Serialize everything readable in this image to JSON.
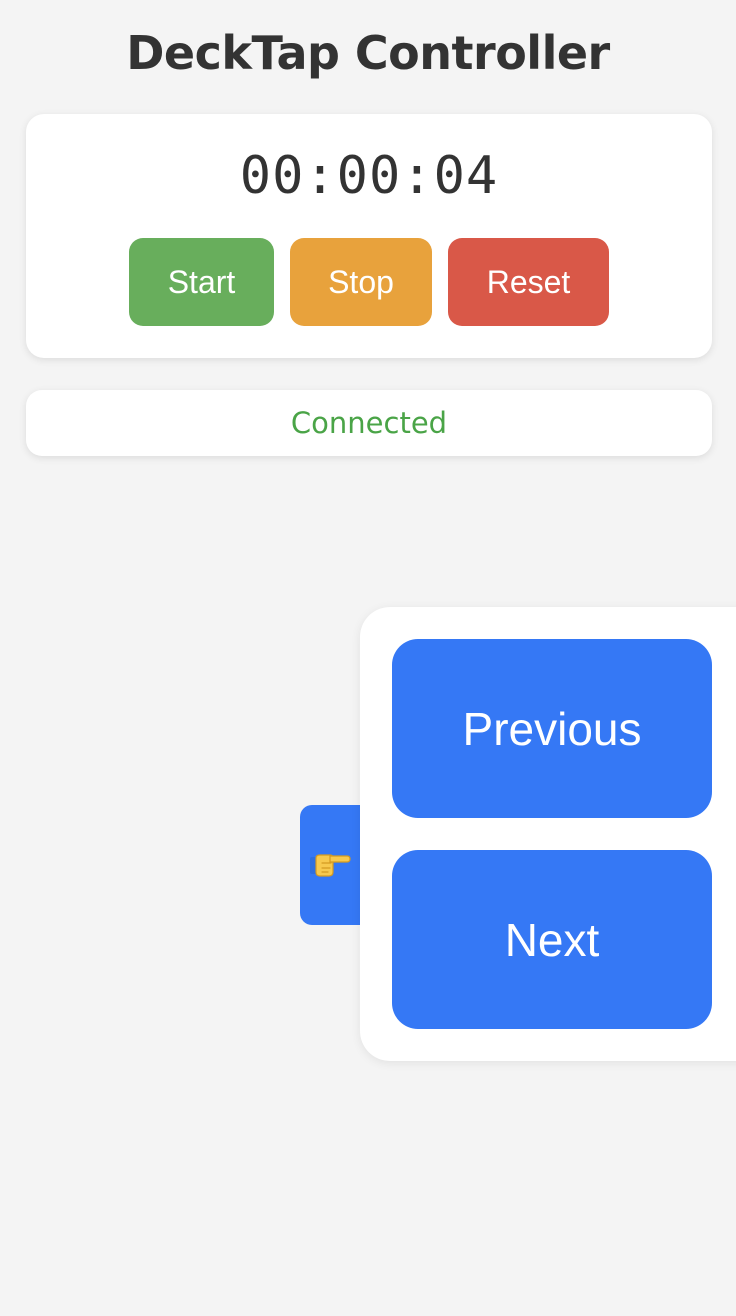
{
  "header": {
    "title": "DeckTap Controller"
  },
  "timer": {
    "display": "00:00:04",
    "start_label": "Start",
    "stop_label": "Stop",
    "reset_label": "Reset"
  },
  "status": {
    "text": "Connected",
    "color": "#4aa447"
  },
  "navigation": {
    "toggle_icon": "pointing-hand-icon",
    "previous_label": "Previous",
    "next_label": "Next"
  },
  "colors": {
    "background": "#f4f4f4",
    "start": "#68ae5c",
    "stop": "#e8a23c",
    "reset": "#d95848",
    "nav_accent": "#3578f5"
  }
}
